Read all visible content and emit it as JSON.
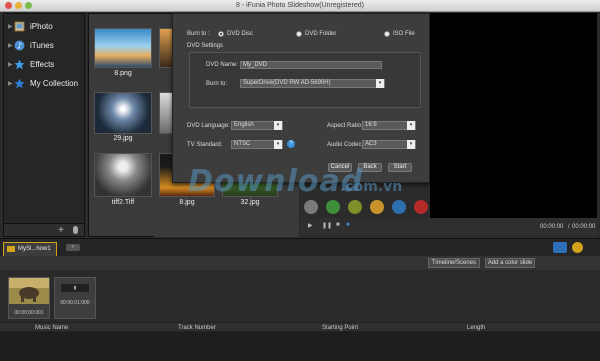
{
  "window": {
    "title": "8 - iFunia Photo Slideshow(Unregistered)"
  },
  "sidebar": {
    "items": [
      {
        "label": "iPhoto",
        "icon": "iphoto-icon"
      },
      {
        "label": "iTunes",
        "icon": "itunes-icon"
      },
      {
        "label": "Effects",
        "icon": "effects-icon"
      },
      {
        "label": "My Collection",
        "icon": "star-icon"
      }
    ],
    "add_label": "+"
  },
  "media": {
    "items": [
      {
        "caption": "8.png"
      },
      {
        "caption": "29.jpg"
      },
      {
        "caption": "tiff2.Tiff"
      },
      {
        "caption": "8.jpg"
      },
      {
        "caption": "32.jpg"
      }
    ]
  },
  "burn_dialog": {
    "burn_to_label": "Burn to :",
    "options": [
      "DVD Disc",
      "DVD Folder",
      "ISO File"
    ],
    "selected_option": "DVD Disc",
    "dvd_settings_label": "DVD Settings",
    "dvd_name_label": "DVD Name:",
    "dvd_name_value": "My_DVD",
    "burn_to_device_label": "Burn to:",
    "burn_to_device_value": "SuperDrive(DVD RW AD-5690H)",
    "dvd_language_label": "DVD Language:",
    "dvd_language_value": "English",
    "aspect_ratio_label": "Aspect Ratio:",
    "aspect_ratio_value": "16:9",
    "tv_standard_label": "TV Standard:",
    "tv_standard_value": "NTSC",
    "audio_codec_label": "Audio Codec:",
    "audio_codec_value": "AC3",
    "cancel_label": "Cancel",
    "back_label": "Back",
    "start_label": "Start"
  },
  "watermark": {
    "text": "Download",
    "sub": ".com.vn"
  },
  "player": {
    "current_time": "00:00:00",
    "separator": "/",
    "total_time": "00:00:00"
  },
  "color_dots": [
    "#7a7a7a",
    "#3f8f3a",
    "#7c8f29",
    "#c9922a",
    "#2f6fb0",
    "#b32a28"
  ],
  "bottom": {
    "tab_label": "MySl...how1",
    "timeline_scenes_label": "Timeline/Scenes",
    "add_color_slide_label": "Add a color slide",
    "clips": [
      {
        "time": "00:00:00:001"
      },
      {
        "time": "00:00:01:000"
      }
    ],
    "music_columns": [
      "Music Name",
      "Track Number",
      "Starting Point",
      "Length"
    ]
  }
}
